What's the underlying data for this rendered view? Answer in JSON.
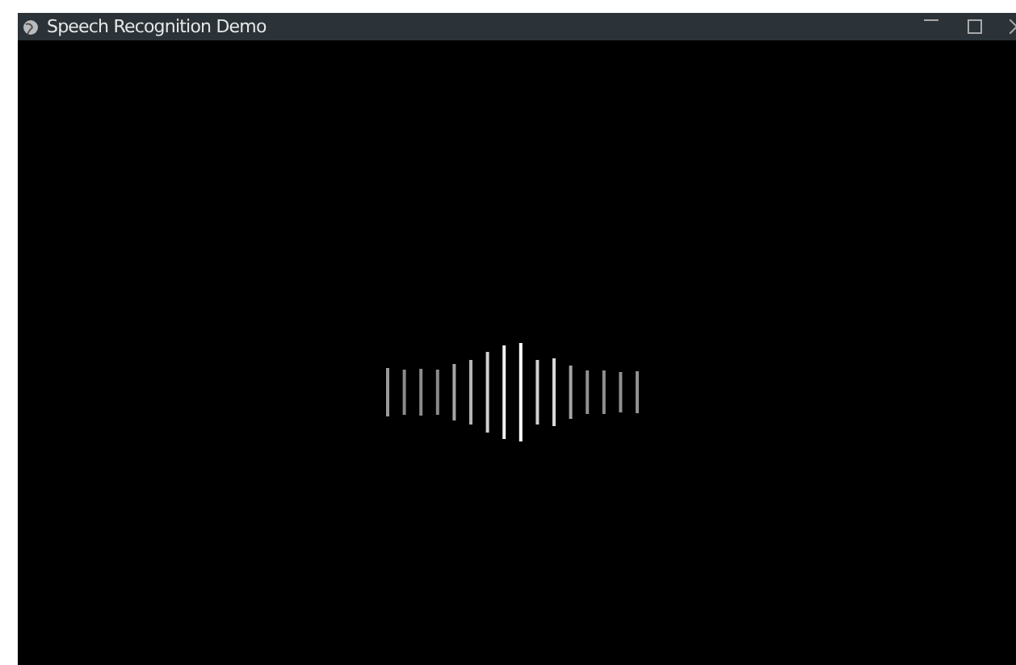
{
  "window": {
    "title": "Speech Recognition Demo"
  }
}
